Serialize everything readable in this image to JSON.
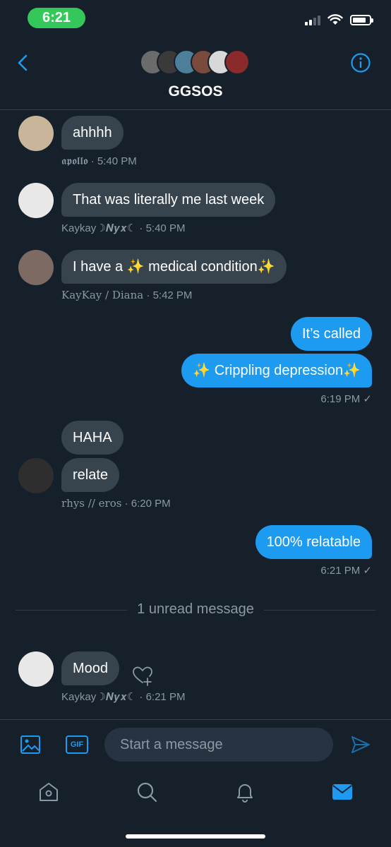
{
  "status_bar": {
    "time": "6:21"
  },
  "header": {
    "title": "GGSOS"
  },
  "messages": [
    {
      "text": "ahhhh",
      "sender": "𝖆𝖕𝖔𝖑𝖑𝖔",
      "time": "5:40 PM"
    },
    {
      "text": "That was literally me last week",
      "sender": "Kaykay☽𝑵𝒚𝒙☾",
      "time": "5:40 PM"
    },
    {
      "text": "I have a ✨ medical condition✨",
      "sender": "KayKay / Diana",
      "time": "5:42 PM"
    },
    {
      "text": "It’s called"
    },
    {
      "text": "✨ Crippling depression✨",
      "time": "6:19 PM ✓"
    },
    {
      "text": "HAHA"
    },
    {
      "text": "relate",
      "sender": "rhys // eros",
      "time": "6:20 PM"
    },
    {
      "text": "100% relatable",
      "time": "6:21 PM ✓"
    },
    {
      "text": "Mood",
      "sender": "Kaykay☽𝑵𝒚𝒙☾",
      "time": "6:21 PM"
    }
  ],
  "unread_label": "1 unread message",
  "composer": {
    "placeholder": "Start a message",
    "gif_label": "GIF"
  },
  "colors": {
    "background": "#15202b",
    "incoming": "#38444d",
    "outgoing": "#1d9bf0",
    "accent": "#1d9bf0"
  }
}
